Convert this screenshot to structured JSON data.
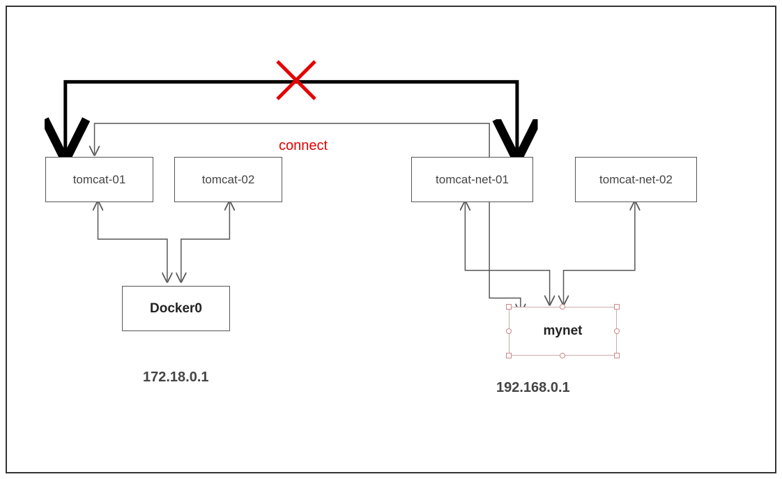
{
  "nodes": {
    "tomcat01": "tomcat-01",
    "tomcat02": "tomcat-02",
    "tomcatnet01": "tomcat-net-01",
    "tomcatnet02": "tomcat-net-02",
    "docker0": "Docker0",
    "mynet": "mynet"
  },
  "labels": {
    "connect": "connect",
    "docker0_ip": "172.18.0.1",
    "mynet_ip": "192.168.0.1"
  },
  "colors": {
    "cross": "#e60000",
    "box_border": "#555555",
    "thin_line": "#555555",
    "thick_line": "#000000",
    "connect_text": "#e60000"
  }
}
